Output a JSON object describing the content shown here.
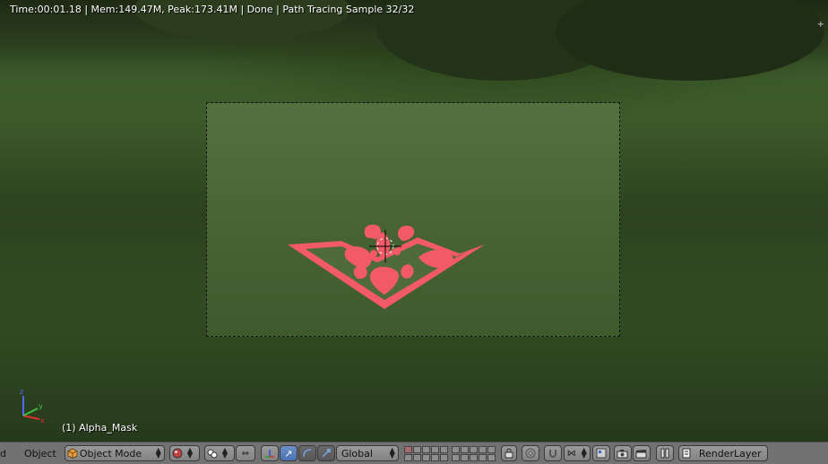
{
  "render_stats": "Time:00:01.18 | Mem:149.47M, Peak:173.41M | Done | Path Tracing Sample 32/32",
  "active_object": "(1) Alpha_Mask",
  "header": {
    "truncated_menu": "d",
    "object_menu": "Object",
    "mode_label": "Object Mode",
    "orientation_label": "Global",
    "render_layer_label": "RenderLayer"
  },
  "colors": {
    "decal": "#f25a68",
    "header_bg": "#727272",
    "manipulator_active": "#5680c2"
  },
  "icons": {
    "mode": "cube-icon",
    "shading": "sphere-shading-icon",
    "pivot": "pivot-point-icon",
    "manipulator_toggle": "axis-manipulator-icon",
    "translate": "translate-arrow-icon",
    "rotate": "rotate-arc-icon",
    "scale": "scale-icon",
    "lock_camera": "lock-icon",
    "proportional": "proportional-edit-icon",
    "snap": "magnet-icon",
    "snap_target": "snap-target-icon",
    "render_still": "camera-icon",
    "render_anim": "clapper-icon",
    "layer_toggle": "layer-pause-icon",
    "render_layer": "render-layer-icon"
  }
}
